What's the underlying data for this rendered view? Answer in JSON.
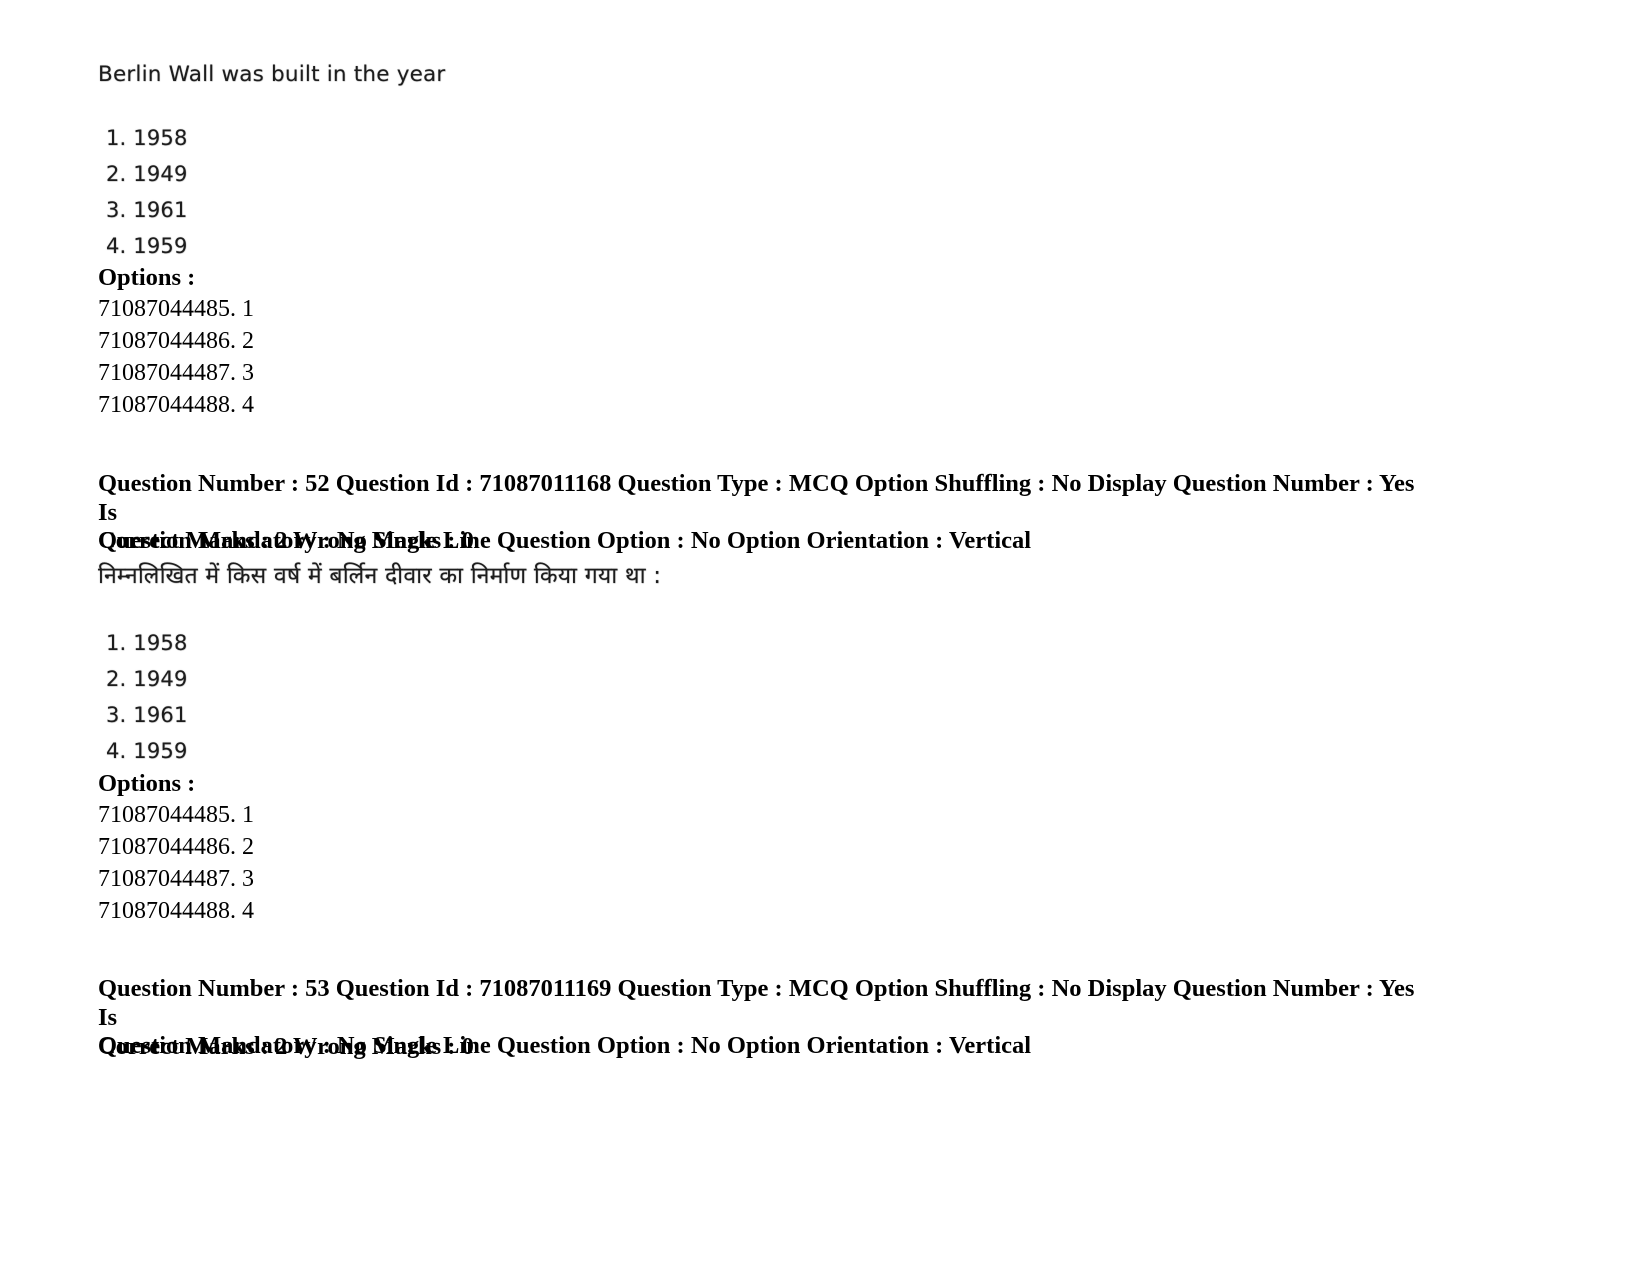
{
  "document": {
    "type": "exam-question-paper",
    "background_color": "#ffffff",
    "text_color": "#000000"
  },
  "question_51": {
    "stem": "Berlin Wall was built in the year",
    "choices": [
      "1. 1958",
      "2. 1949",
      "3. 1961",
      "4. 1959"
    ],
    "options_label": "Options :",
    "option_ids": [
      "71087044485. 1",
      "71087044486. 2",
      "71087044487. 3",
      "71087044488. 4"
    ]
  },
  "question_52": {
    "meta_line_1": "Question Number : 52 Question Id : 71087011168 Question Type : MCQ Option Shuffling : No Display Question Number : Yes Is",
    "meta_line_2": "Question Mandatory : No Single Line Question Option : No Option Orientation : Vertical",
    "marks_line": "Correct Marks : 2 Wrong Marks : 0",
    "question_number": "52",
    "question_id": "71087011168",
    "question_type": "MCQ",
    "option_shuffling": "No",
    "display_question_number": "Yes",
    "is_question_mandatory": "No",
    "single_line_question_option": "No",
    "option_orientation": "Vertical",
    "correct_marks": "2",
    "wrong_marks": "0",
    "stem": "निम्नलिखित में किस वर्ष में बर्लिन दीवार का निर्माण किया गया था :",
    "choices": [
      "1. 1958",
      "2. 1949",
      "3. 1961",
      "4. 1959"
    ],
    "options_label": "Options :",
    "option_ids": [
      "71087044485. 1",
      "71087044486. 2",
      "71087044487. 3",
      "71087044488. 4"
    ]
  },
  "question_53": {
    "meta_line_1": "Question Number : 53 Question Id : 71087011169 Question Type : MCQ Option Shuffling : No Display Question Number : Yes Is",
    "meta_line_2": "Question Mandatory : No Single Line Question Option : No Option Orientation : Vertical",
    "marks_line": "Correct Marks : 2 Wrong Marks : 0",
    "question_number": "53",
    "question_id": "71087011169",
    "question_type": "MCQ",
    "option_shuffling": "No",
    "display_question_number": "Yes",
    "is_question_mandatory": "No",
    "single_line_question_option": "No",
    "option_orientation": "Vertical",
    "correct_marks": "2",
    "wrong_marks": "0"
  }
}
